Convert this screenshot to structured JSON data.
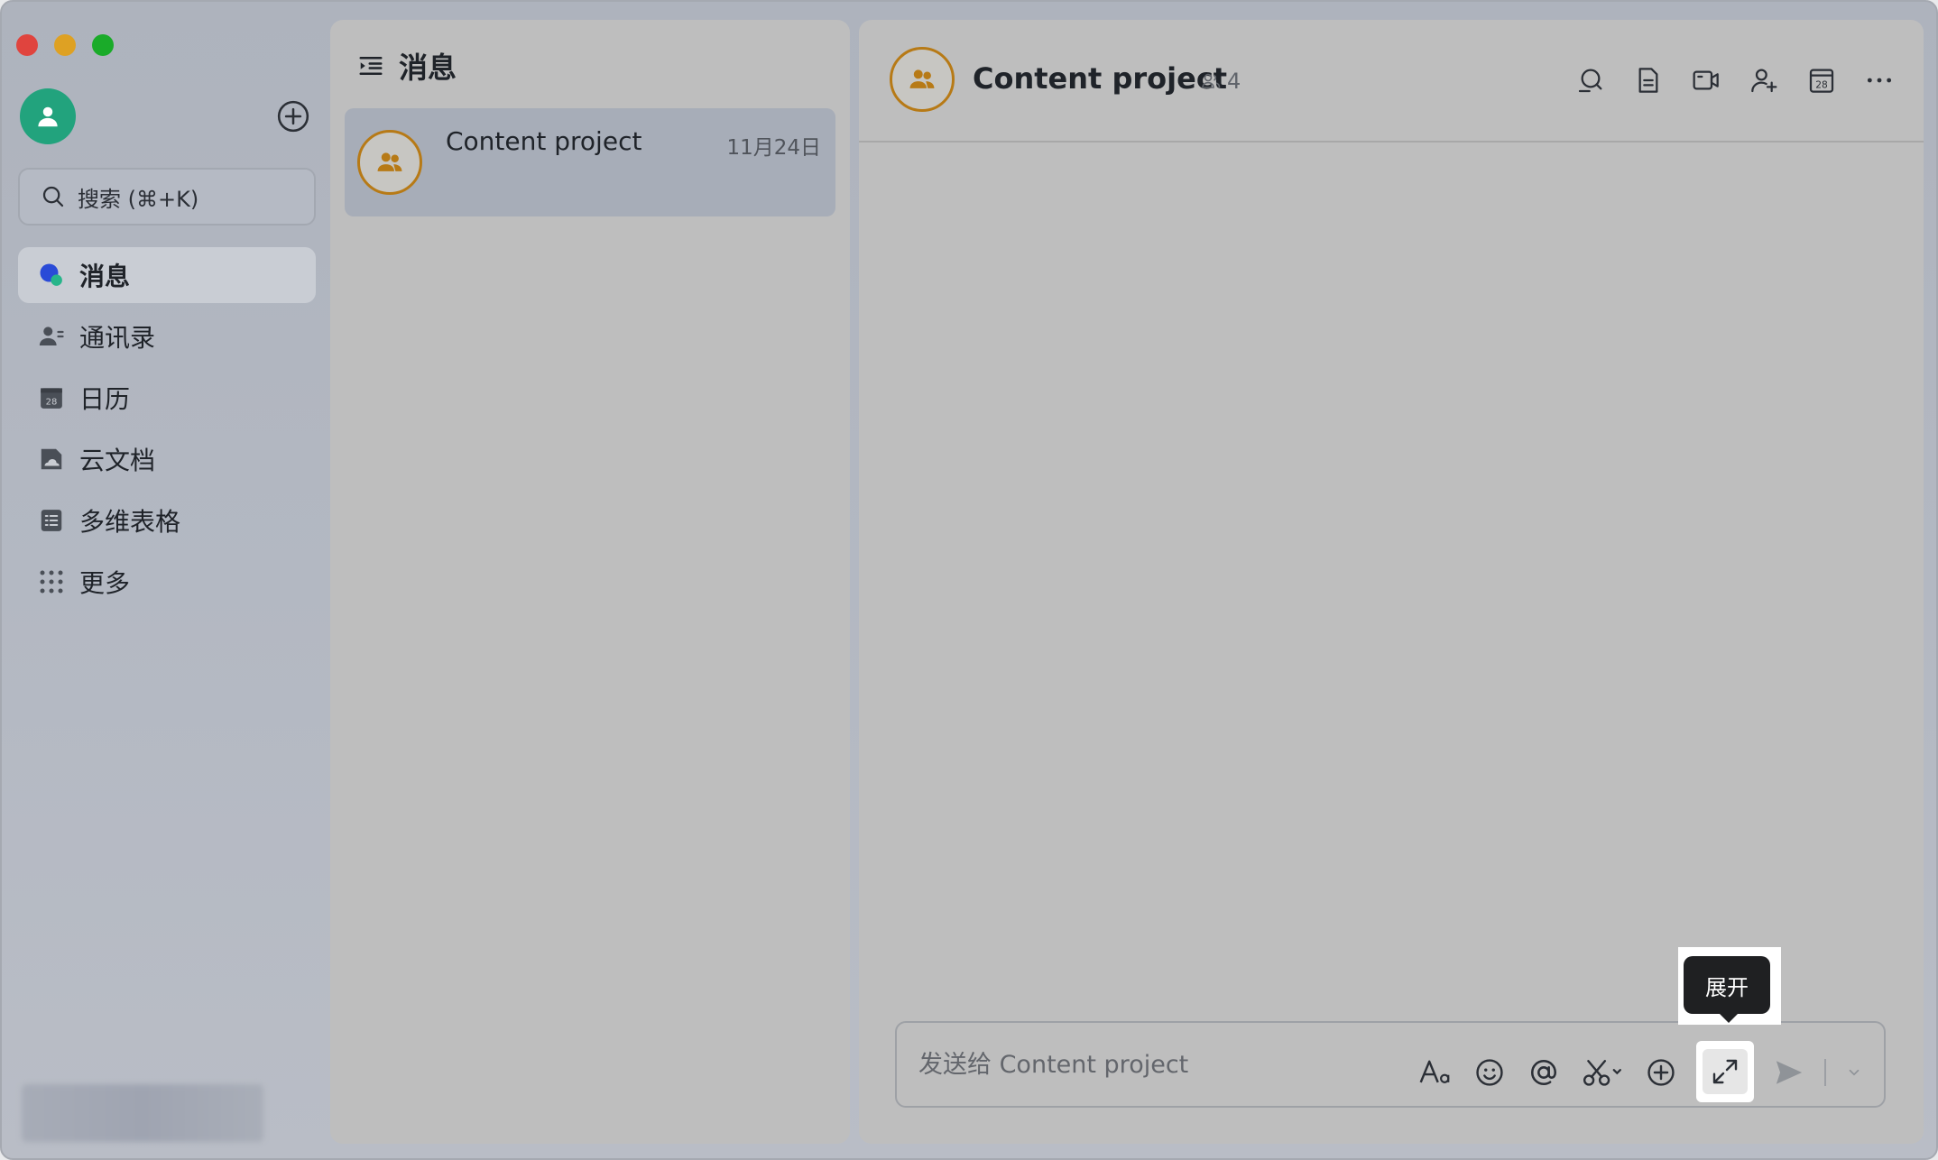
{
  "window": {
    "controls": [
      "close",
      "minimize",
      "maximize"
    ]
  },
  "sidebar": {
    "search_placeholder": "搜索 (⌘+K)",
    "items": [
      {
        "label": "消息",
        "icon": "messages-icon",
        "active": true
      },
      {
        "label": "通讯录",
        "icon": "contacts-icon",
        "active": false
      },
      {
        "label": "日历",
        "icon": "calendar-icon",
        "active": false
      },
      {
        "label": "云文档",
        "icon": "cloud-docs-icon",
        "active": false
      },
      {
        "label": "多维表格",
        "icon": "base-table-icon",
        "active": false
      },
      {
        "label": "更多",
        "icon": "more-apps-icon",
        "active": false
      }
    ]
  },
  "list": {
    "header": "消息",
    "chats": [
      {
        "name": "Content project",
        "date": "11月24日"
      }
    ]
  },
  "chat": {
    "title": "Content project",
    "member_count": "4",
    "composer_placeholder": "发送给 Content project",
    "tooltip": "展开",
    "header_tools": [
      "search-icon",
      "document-icon",
      "video-call-icon",
      "add-member-icon",
      "calendar-icon",
      "more-icon"
    ],
    "composer_tools": [
      "format-icon",
      "emoji-icon",
      "mention-icon",
      "screenshot-icon",
      "plus-icon",
      "expand-icon",
      "send-icon"
    ]
  },
  "colors": {
    "accent_green": "#22a37d",
    "group_border": "#b77a16",
    "tooltip_bg": "#1f2022"
  }
}
